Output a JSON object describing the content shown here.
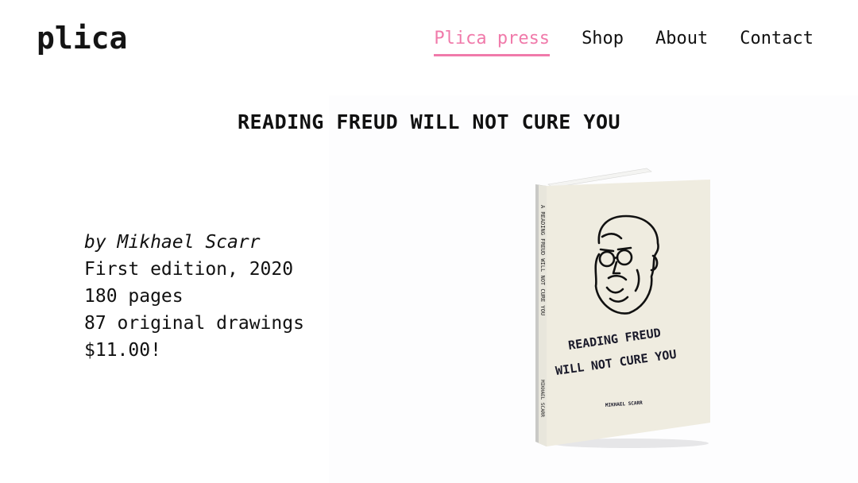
{
  "header": {
    "logo": "plica",
    "nav": [
      {
        "label": "Plica press",
        "active": true
      },
      {
        "label": "Shop",
        "active": false
      },
      {
        "label": "About",
        "active": false
      },
      {
        "label": "Contact",
        "active": false
      }
    ]
  },
  "book": {
    "title": "READING FREUD WILL NOT CURE YOU",
    "author_line": "by Mikhael Scarr",
    "edition": "First edition, 2020",
    "pages": "180 pages",
    "drawings": "87 original drawings",
    "price": "$11.00!"
  },
  "cover": {
    "title_line1": "READING FREUD",
    "title_line2": "WILL NOT CURE YOU",
    "author": "MIKHAEL SCARR",
    "spine_text": "A READING FREUD WILL NOT CURE YOU",
    "spine_author": "MIKHAEL SCARR",
    "cover_color": "#efece0"
  },
  "colors": {
    "accent": "#f07aaa",
    "text": "#111111"
  }
}
